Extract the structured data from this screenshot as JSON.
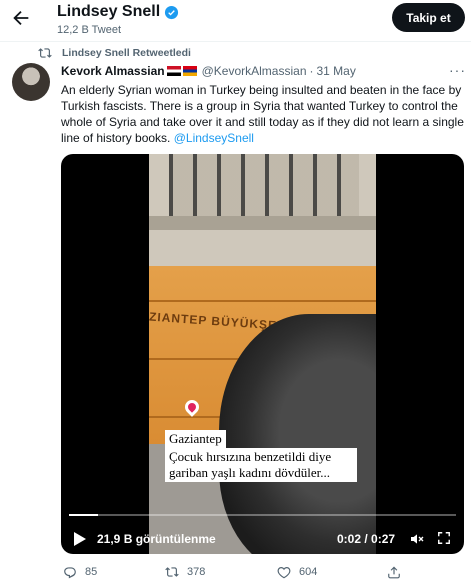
{
  "header": {
    "profile_name": "Lindsey Snell",
    "tweet_count": "12,2 B Tweet",
    "follow_label": "Takip et"
  },
  "retweet": {
    "label": "Lindsey Snell Retweetledi"
  },
  "tweet": {
    "author_name": "Kevork Almassian",
    "handle": "@KevorkAlmassian",
    "dot": "·",
    "date": "31 May",
    "more": "···",
    "text": "An elderly Syrian woman in Turkey being insulted and beaten in the face by Turkish fascists. There is a group in Syria that wanted Turkey to control the whole of Syria and take over it and still today as if they did not learn a single line of history books.",
    "mention": "@LindseySnell"
  },
  "video": {
    "bench_text": "ZIANTEP BÜYÜKŞE",
    "caption_location": "Gaziantep",
    "caption_text": "Çocuk hırsızına benzetildi diye gariban yaşlı kadını dövdüler...",
    "views": "21,9 B görüntülenme",
    "time": "0:02 / 0:27",
    "progress": 0.074
  },
  "actions": {
    "replies": "85",
    "retweets": "378",
    "likes": "604"
  },
  "colors": {
    "accent": "#1d9bf0",
    "text": "#0f1419",
    "secondary": "#536471",
    "follow_bg": "#0f1419"
  },
  "icons": [
    "back-arrow-icon",
    "verified-badge-icon",
    "retweet-icon",
    "play-icon",
    "mute-icon",
    "fullscreen-icon",
    "reply-icon",
    "like-icon",
    "share-icon"
  ]
}
